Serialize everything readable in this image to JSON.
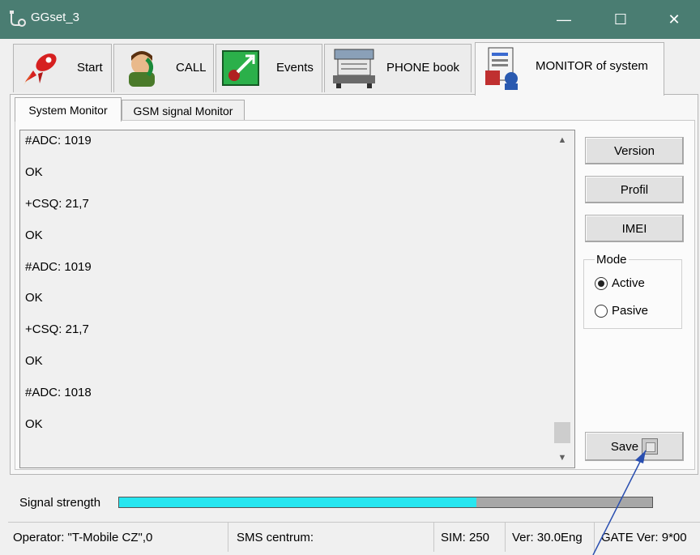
{
  "window": {
    "title": "GGset_3",
    "controls": {
      "minimize": "—",
      "maximize": "☐",
      "close": "✕"
    }
  },
  "main_tabs": [
    {
      "label": "Start",
      "icon": "rocket-icon"
    },
    {
      "label": "CALL",
      "icon": "phone-call-icon"
    },
    {
      "label": "Events",
      "icon": "events-icon"
    },
    {
      "label": "PHONE book",
      "icon": "phonebook-icon"
    },
    {
      "label": "MONITOR of system",
      "icon": "monitor-icon",
      "active": true
    }
  ],
  "sub_tabs": [
    {
      "label": "System Monitor",
      "active": true
    },
    {
      "label": "GSM signal Monitor"
    }
  ],
  "log_lines": [
    "#ADC: 1019",
    "OK",
    "+CSQ: 21,7",
    "OK",
    "#ADC: 1019",
    "OK",
    "+CSQ: 21,7",
    "OK",
    "#ADC: 1018",
    "OK"
  ],
  "buttons": {
    "version": "Version",
    "profil": "Profil",
    "imei": "IMEI",
    "save": "Save"
  },
  "mode": {
    "legend": "Mode",
    "options": [
      {
        "label": "Active",
        "selected": true
      },
      {
        "label": "Pasive",
        "selected": false
      }
    ]
  },
  "signal": {
    "label": "Signal strength",
    "level_percent": 67,
    "fill_color": "#27e6f0"
  },
  "status": {
    "operator": "Operator: \"T-Mobile CZ\",0",
    "sms_centrum": "SMS centrum:",
    "sim": "SIM: 250",
    "ver": "Ver: 30.0Eng",
    "gate_ver": "GATE Ver: 9*00"
  },
  "colors": {
    "titlebar": "#4a7d72",
    "annotation_arrow": "#2a4fb0"
  }
}
